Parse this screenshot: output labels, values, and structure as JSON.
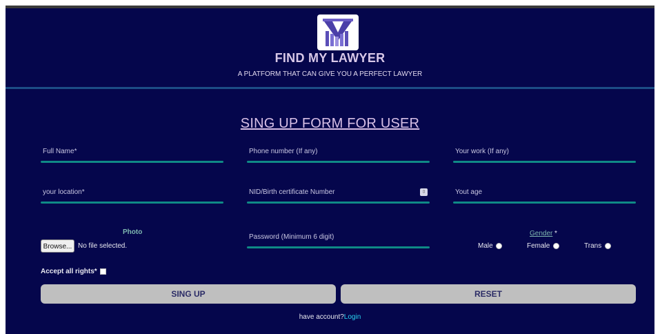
{
  "header": {
    "brand": "FIND MY LAWYER",
    "tagline": "A PLATFORM THAT CAN GIVE YOU A PERFECT LAWYER",
    "logo_icon": "m-logo-icon"
  },
  "form": {
    "title": "SING UP FORM FOR USER",
    "fields": {
      "full_name": "Full Name*",
      "phone": "Phone number (If any)",
      "work": "Your work (If any)",
      "location": "your location*",
      "nid": "NID/Birth certificate Number",
      "age": "Yout age",
      "password": "Password (Minimum 6 digit)"
    },
    "photo": {
      "label": "Photo",
      "browse": "Browse...",
      "status": "No file selected."
    },
    "gender": {
      "label": "Gender",
      "required": "*",
      "options": [
        "Male",
        "Female",
        "Trans"
      ]
    },
    "accept": "Accept all rights*",
    "buttons": {
      "signup": "SING UP",
      "reset": "RESET"
    },
    "footer": {
      "text": "have account?",
      "link": "Login"
    }
  },
  "colors": {
    "background": "#05064c",
    "accent_line": "#0f8a86",
    "link": "#29d3f0",
    "button": "#bfbfbf"
  }
}
